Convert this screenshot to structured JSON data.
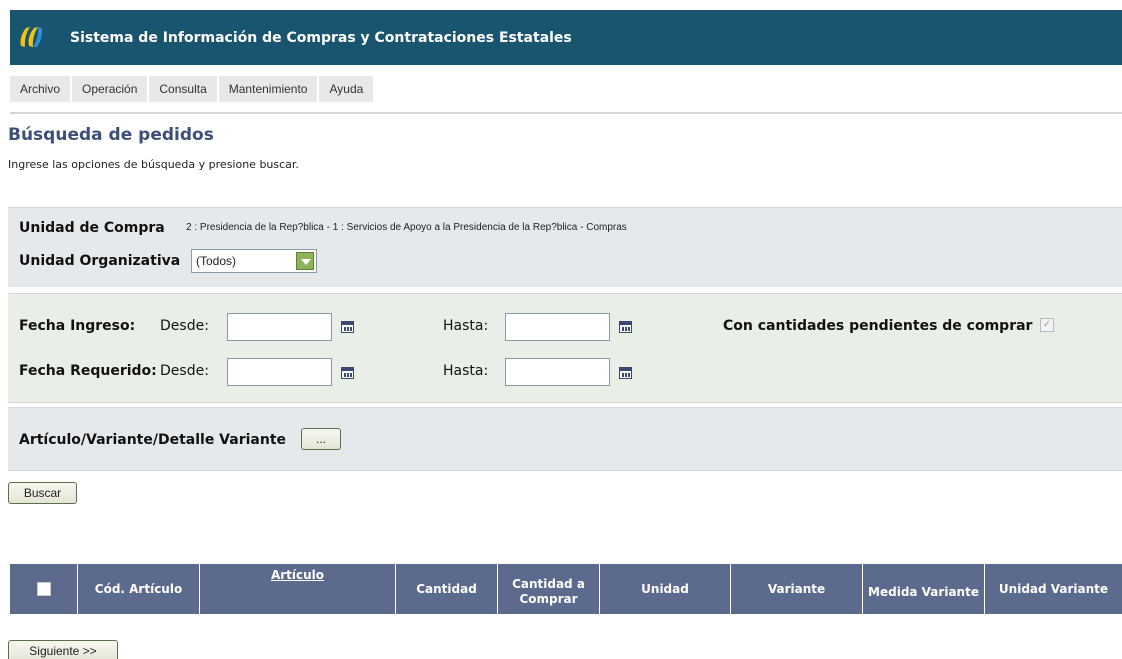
{
  "header": {
    "title": "Sistema de Información de Compras y Contrataciones Estatales"
  },
  "menu": [
    "Archivo",
    "Operación",
    "Consulta",
    "Mantenimiento",
    "Ayuda"
  ],
  "page": {
    "title": "Búsqueda de pedidos",
    "subtitle": "Ingrese las opciones de búsqueda y presione buscar."
  },
  "unit_panel": {
    "unidad_compra_label": "Unidad de Compra",
    "unidad_compra_value": "2 : Presidencia de la Rep?blica - 1 : Servicios de Apoyo a la Presidencia de la Rep?blica - Compras",
    "unidad_organizativa_label": "Unidad Organizativa",
    "unidad_organizativa_value": "(Todos)"
  },
  "dates_panel": {
    "fecha_ingreso_label": "Fecha Ingreso:",
    "fecha_requerido_label": "Fecha Requerido:",
    "desde_label": "Desde:",
    "hasta_label": "Hasta:",
    "fecha_ingreso_desde": "",
    "fecha_ingreso_hasta": "",
    "fecha_requerido_desde": "",
    "fecha_requerido_hasta": "",
    "pendientes_label": "Con cantidades pendientes de comprar",
    "pendientes_checked": true
  },
  "article_panel": {
    "label": "Artículo/Variante/Detalle Variante",
    "button": "..."
  },
  "buttons": {
    "buscar": "Buscar",
    "siguiente": "Siguiente >>"
  },
  "table": {
    "columns": [
      "",
      "Cód. Artículo",
      "Artículo",
      "Cantidad",
      "Cantidad a Comprar",
      "Unidad",
      "Variante",
      "Medida Variante",
      "Unidad Variante"
    ]
  },
  "colors": {
    "header_bg": "#1a5570",
    "table_header_bg": "#5c6a8d",
    "title": "#3d4f78"
  }
}
